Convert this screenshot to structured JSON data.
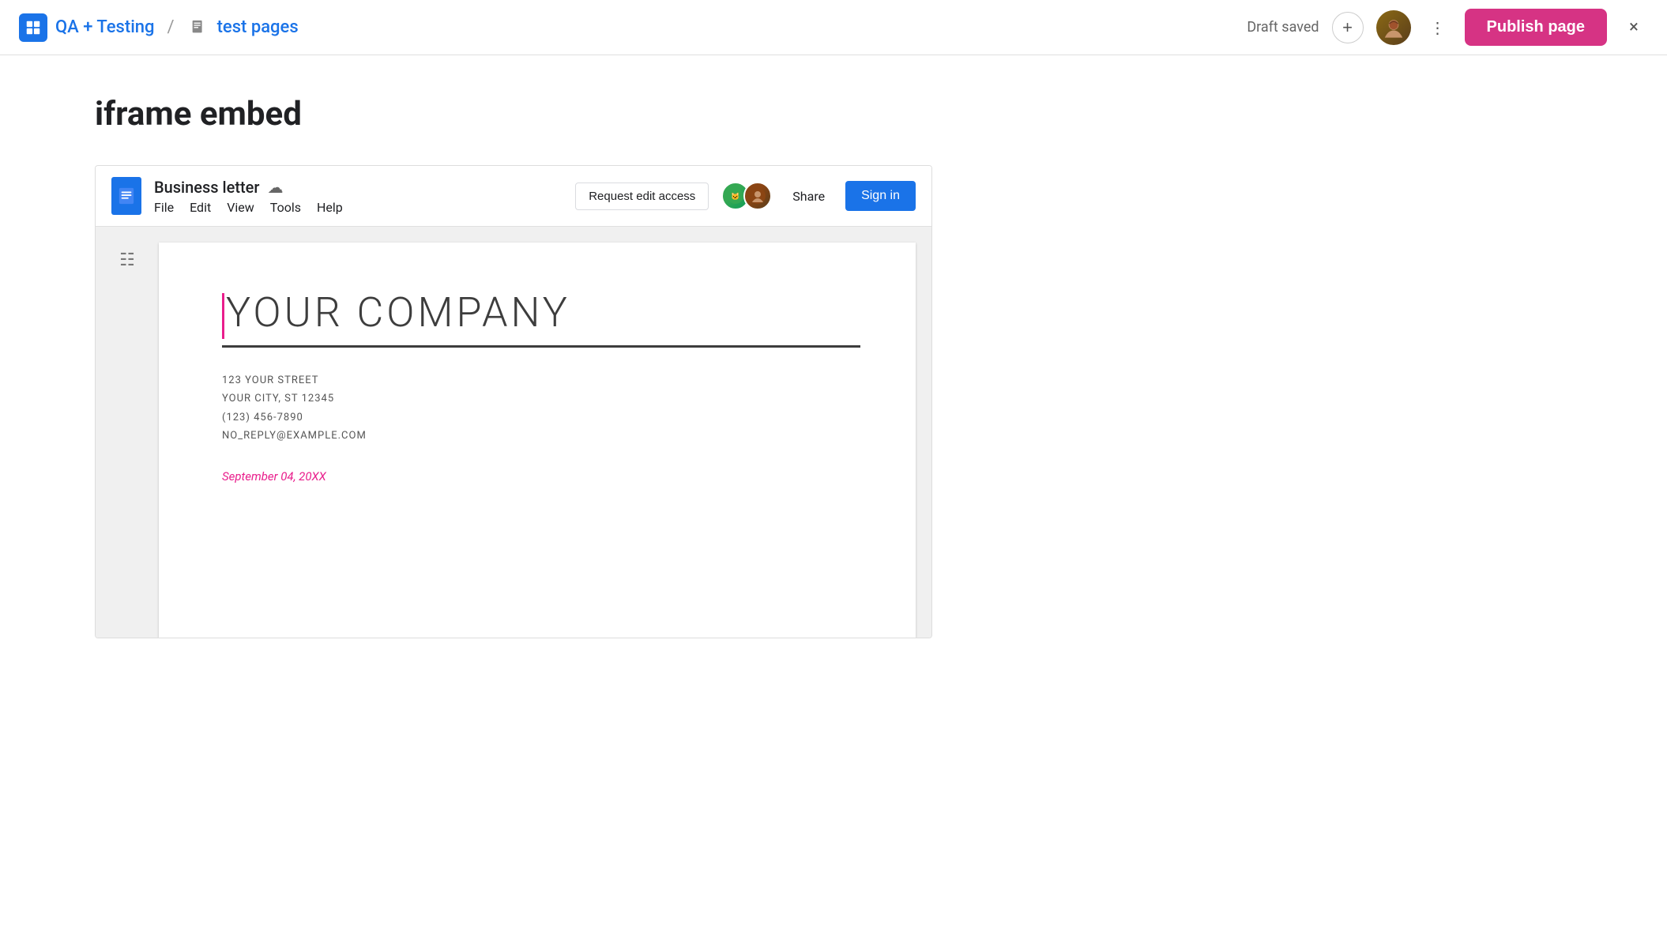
{
  "topbar": {
    "workspace_label": "QA + Testing",
    "separator": "/",
    "page_name": "test pages",
    "draft_status": "Draft saved",
    "add_button_label": "+",
    "more_dots": "⋮",
    "publish_button_label": "Publish page",
    "close_label": "×"
  },
  "page": {
    "title": "iframe embed"
  },
  "gdoc": {
    "doc_title": "Business letter",
    "menu_items": [
      "File",
      "Edit",
      "View",
      "Tools",
      "Help"
    ],
    "request_btn": "Request edit access",
    "share_label": "Share",
    "signin_label": "Sign in",
    "company_name": "YOUR COMPANY",
    "address_line1": "123 YOUR STREET",
    "address_line2": "YOUR CITY, ST 12345",
    "phone": "(123) 456-7890",
    "email": "NO_REPLY@EXAMPLE.COM",
    "date": "September 04, 20XX"
  }
}
